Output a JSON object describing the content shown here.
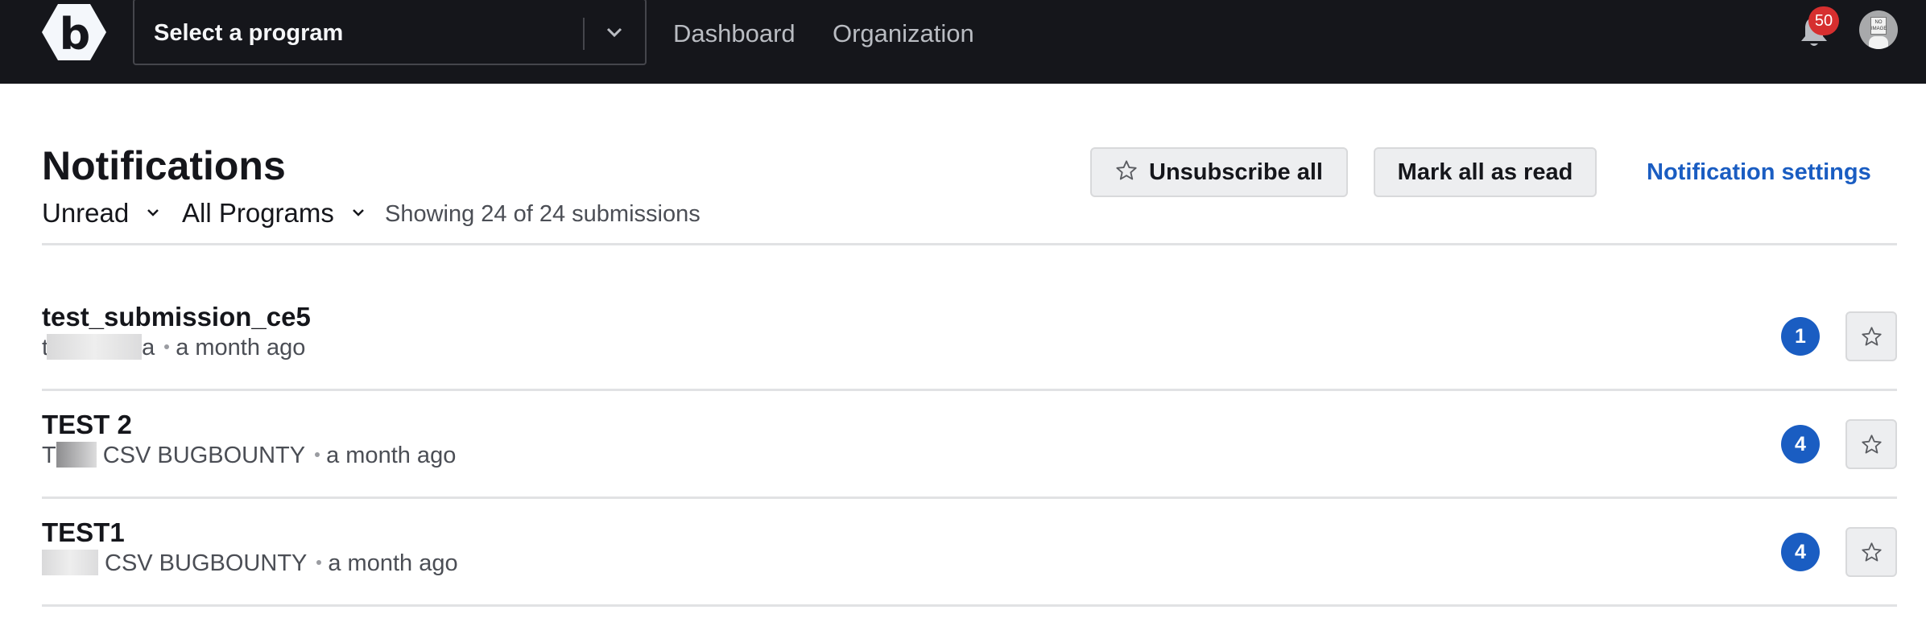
{
  "header": {
    "logo_letter": "b",
    "program_select": {
      "placeholder": "Select a program"
    },
    "nav": [
      {
        "label": "Dashboard"
      },
      {
        "label": "Organization"
      }
    ],
    "notification_count": "50",
    "avatar_text": "NO IMAGE",
    "colors": {
      "background": "#15161b",
      "badge": "#d62f2f"
    }
  },
  "page": {
    "title": "Notifications",
    "filters": {
      "status": "Unread",
      "program": "All Programs"
    },
    "showing_text": "Showing 24 of 24 submissions",
    "actions": {
      "unsubscribe_all": "Unsubscribe all",
      "mark_all_read": "Mark all as read",
      "settings_link": "Notification settings"
    },
    "accent_color": "#1a5dc2"
  },
  "notifications": [
    {
      "title": "test_submission_ce5",
      "program_prefix": "t",
      "program_suffix": "a",
      "time": "a month ago",
      "count": "1"
    },
    {
      "title": "TEST 2",
      "program_prefix": "T",
      "program_suffix": "CSV BUGBOUNTY",
      "time": "a month ago",
      "count": "4"
    },
    {
      "title": "TEST1",
      "program_prefix": "",
      "program_suffix": "CSV BUGBOUNTY",
      "time": "a month ago",
      "count": "4"
    }
  ]
}
